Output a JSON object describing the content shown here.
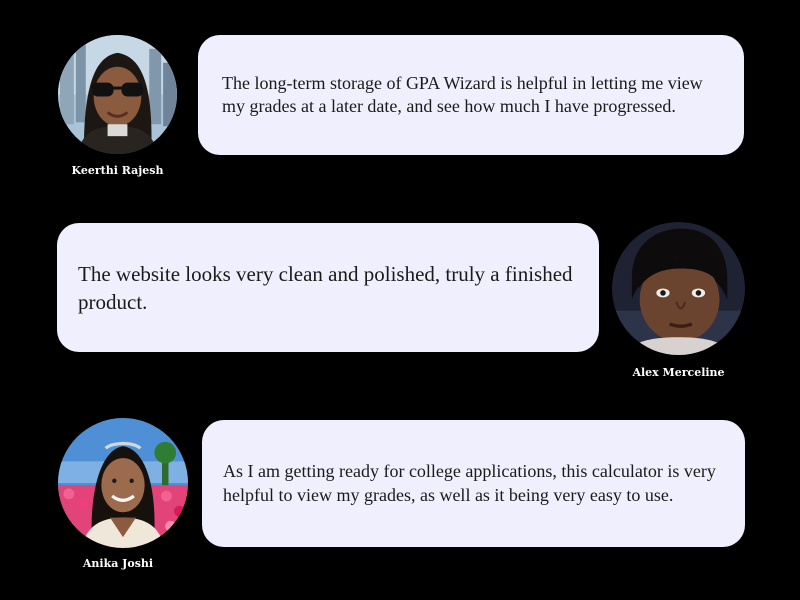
{
  "colors": {
    "background": "#000000",
    "bubble": "#efeffd",
    "text": "#1a1a1a",
    "name_text": "#ffffff"
  },
  "testimonials": [
    {
      "name": "Keerthi Rajesh",
      "quote": "The long-term storage of GPA Wizard is helpful in letting me view my grades at a later date, and see how much I have progressed."
    },
    {
      "name": "Alex Merceline",
      "quote": "The website looks very clean and polished, truly a finished product."
    },
    {
      "name": "Anika Joshi",
      "quote": "As I am getting ready for college applications, this calculator is very helpful to view my grades, as well as it being very easy to use."
    }
  ]
}
